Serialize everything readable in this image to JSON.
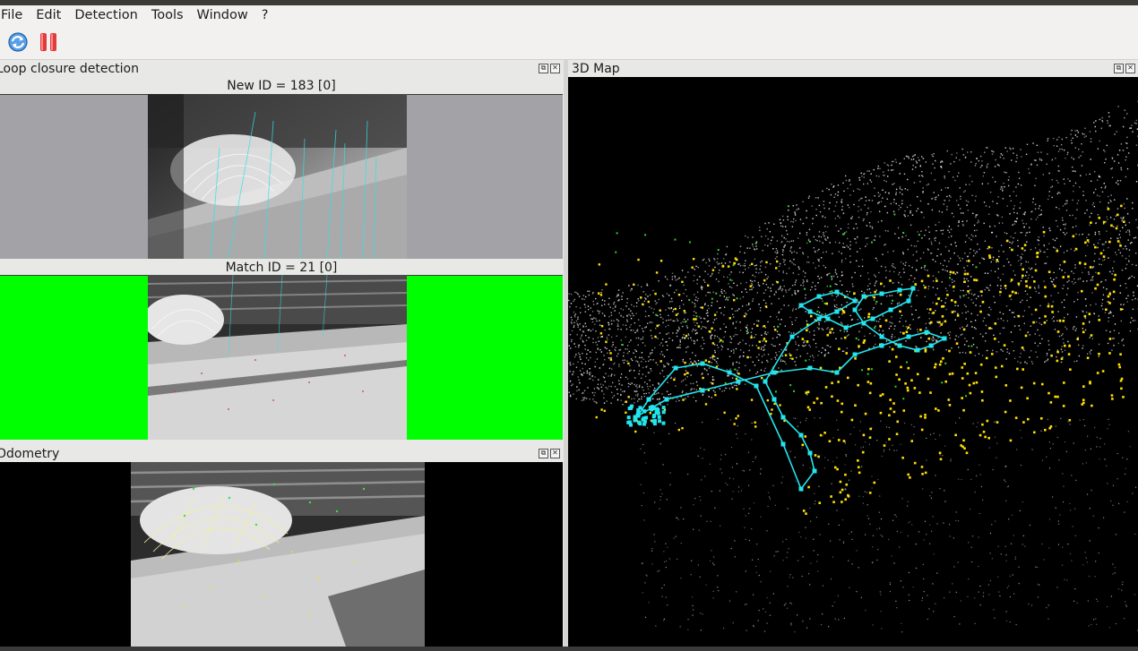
{
  "menu": {
    "items": [
      "File",
      "Edit",
      "Detection",
      "Tools",
      "Window",
      "?"
    ]
  },
  "toolbar": {
    "buttons": [
      {
        "icon": "refresh-icon",
        "color": "#2f7fd6"
      },
      {
        "icon": "pause-icon",
        "color": "#e23b3b"
      }
    ]
  },
  "loop_panel": {
    "title": "Loop closure detection",
    "new_label": "New ID = 183 [0]",
    "match_label": "Match ID = 21 [0]",
    "new_bg": "#a3a2a7",
    "match_bg": "#00ff00"
  },
  "odometry_panel": {
    "title": "Odometry",
    "bg": "#000000"
  },
  "map_panel": {
    "title": "3D Map",
    "bg": "#000000",
    "trajectory_color": "#22e5ee",
    "feature_color": "#ffe000"
  }
}
